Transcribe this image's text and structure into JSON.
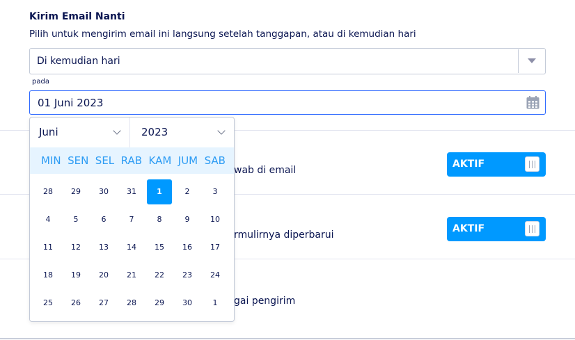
{
  "section": {
    "title": "Kirim Email Nanti",
    "description": "Pilih untuk mengirim email ini langsung setelah tanggapan, atau di kemudian hari"
  },
  "send_option": {
    "selected": "Di kemudian hari"
  },
  "date_field": {
    "label": "pada",
    "value": "01 Juni 2023"
  },
  "rows": [
    {
      "text": "wab di email",
      "toggle": "AKTIF"
    },
    {
      "text": "rmulirnya diperbarui",
      "toggle": "AKTIF"
    },
    {
      "text": "gai pengirim"
    }
  ],
  "datepicker": {
    "month": "Juni",
    "year": "2023",
    "weekdays": [
      "MIN",
      "SEN",
      "SEL",
      "RAB",
      "KAM",
      "JUM",
      "SAB"
    ],
    "weeks": [
      [
        "28",
        "29",
        "30",
        "31",
        "1",
        "2",
        "3"
      ],
      [
        "4",
        "5",
        "6",
        "7",
        "8",
        "9",
        "10"
      ],
      [
        "11",
        "12",
        "13",
        "14",
        "15",
        "16",
        "17"
      ],
      [
        "18",
        "19",
        "20",
        "21",
        "22",
        "23",
        "24"
      ],
      [
        "25",
        "26",
        "27",
        "28",
        "29",
        "30",
        "1"
      ]
    ],
    "selected_day": "1"
  },
  "colors": {
    "accent": "#0099ff",
    "text": "#0a1551",
    "weekday_text": "#2d9cf4",
    "weekday_bg": "#e6f4ff"
  },
  "icons": {
    "date": "calendar-icon",
    "dropdown": "caret-down-icon",
    "select": "chevron-down-icon"
  }
}
